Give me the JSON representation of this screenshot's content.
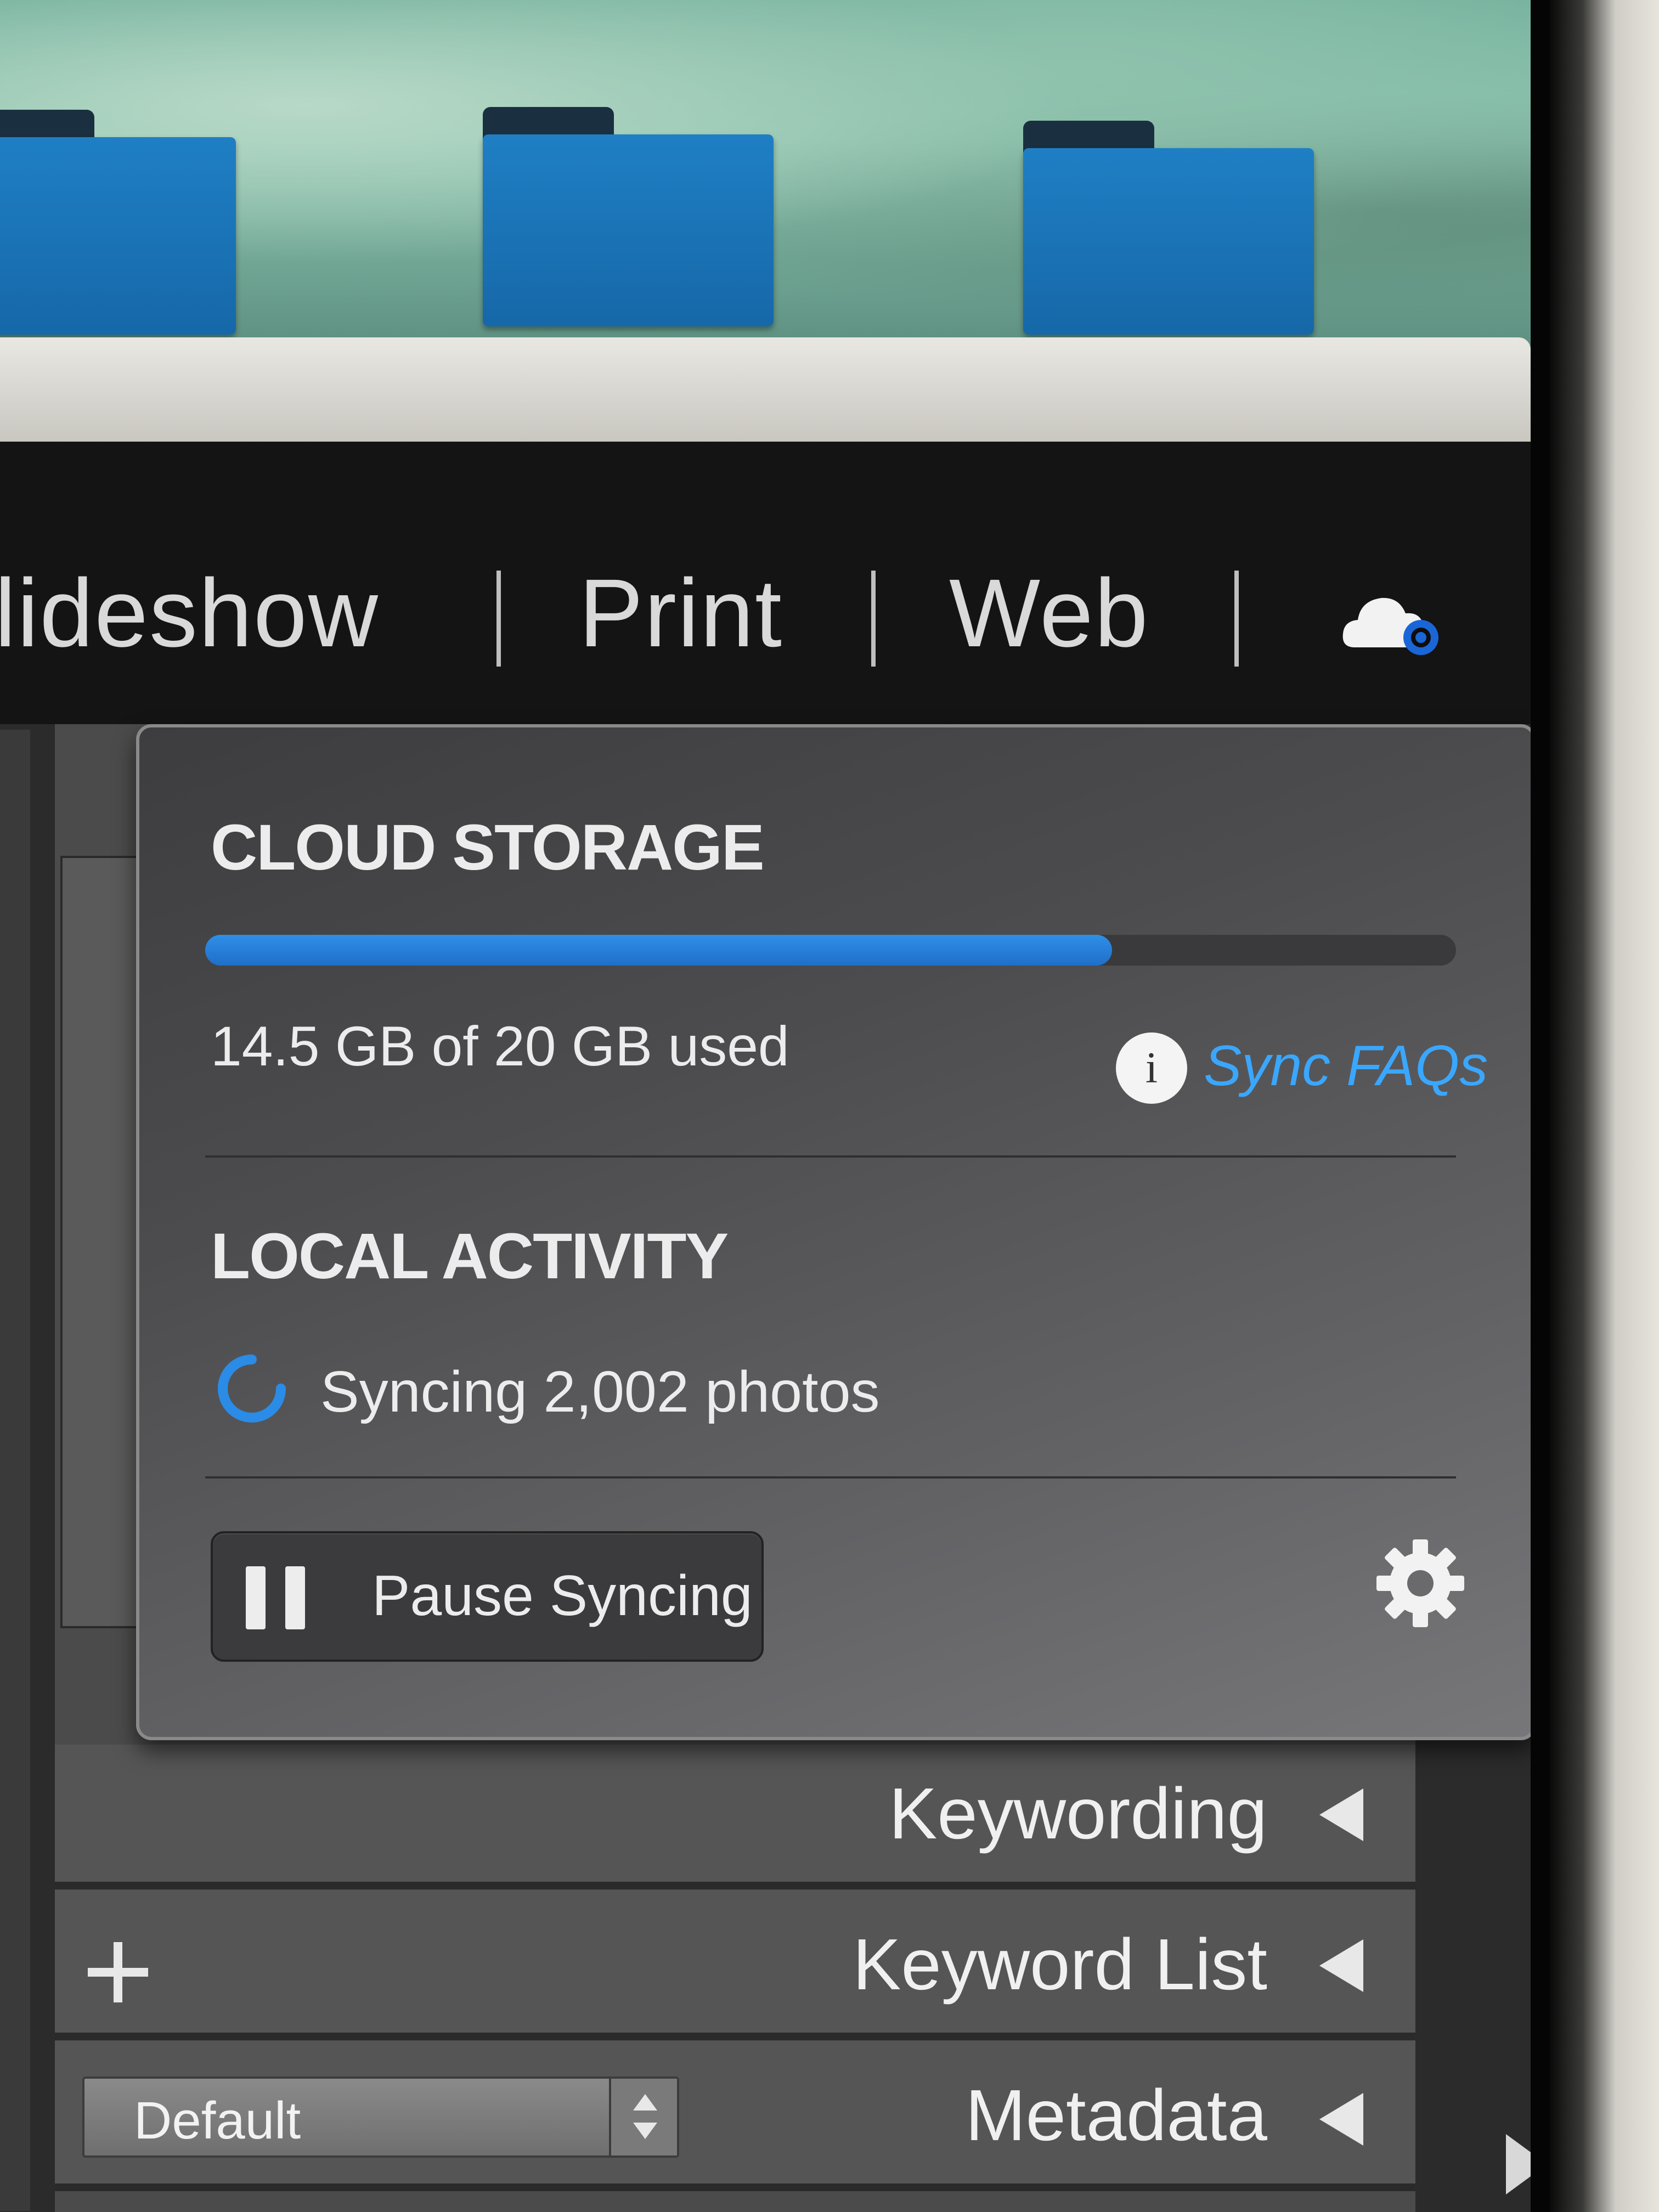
{
  "modules": {
    "slideshow": "lideshow",
    "print": "Print",
    "web": "Web"
  },
  "cloud_popup": {
    "storage_heading": "CLOUD STORAGE",
    "storage_used": "14.5 GB of 20 GB used",
    "storage_fraction": 0.725,
    "info_icon_glyph": "i",
    "sync_faqs_link": "Sync FAQs",
    "activity_heading": "LOCAL ACTIVITY",
    "sync_status": "Syncing 2,002 photos",
    "pause_button": "Pause Syncing",
    "accent_color": "#2f8fe8",
    "link_color": "#3aa7ff"
  },
  "right_panel": {
    "sections": [
      "Keywording",
      "Keyword List",
      "Metadata"
    ],
    "metadata_preset": "Default"
  },
  "icons": [
    "cloud-sync-icon",
    "info-icon",
    "spinner-icon",
    "pause-icon",
    "gear-icon",
    "plus-icon",
    "collapse-triangle-icon",
    "stepper-icon"
  ]
}
